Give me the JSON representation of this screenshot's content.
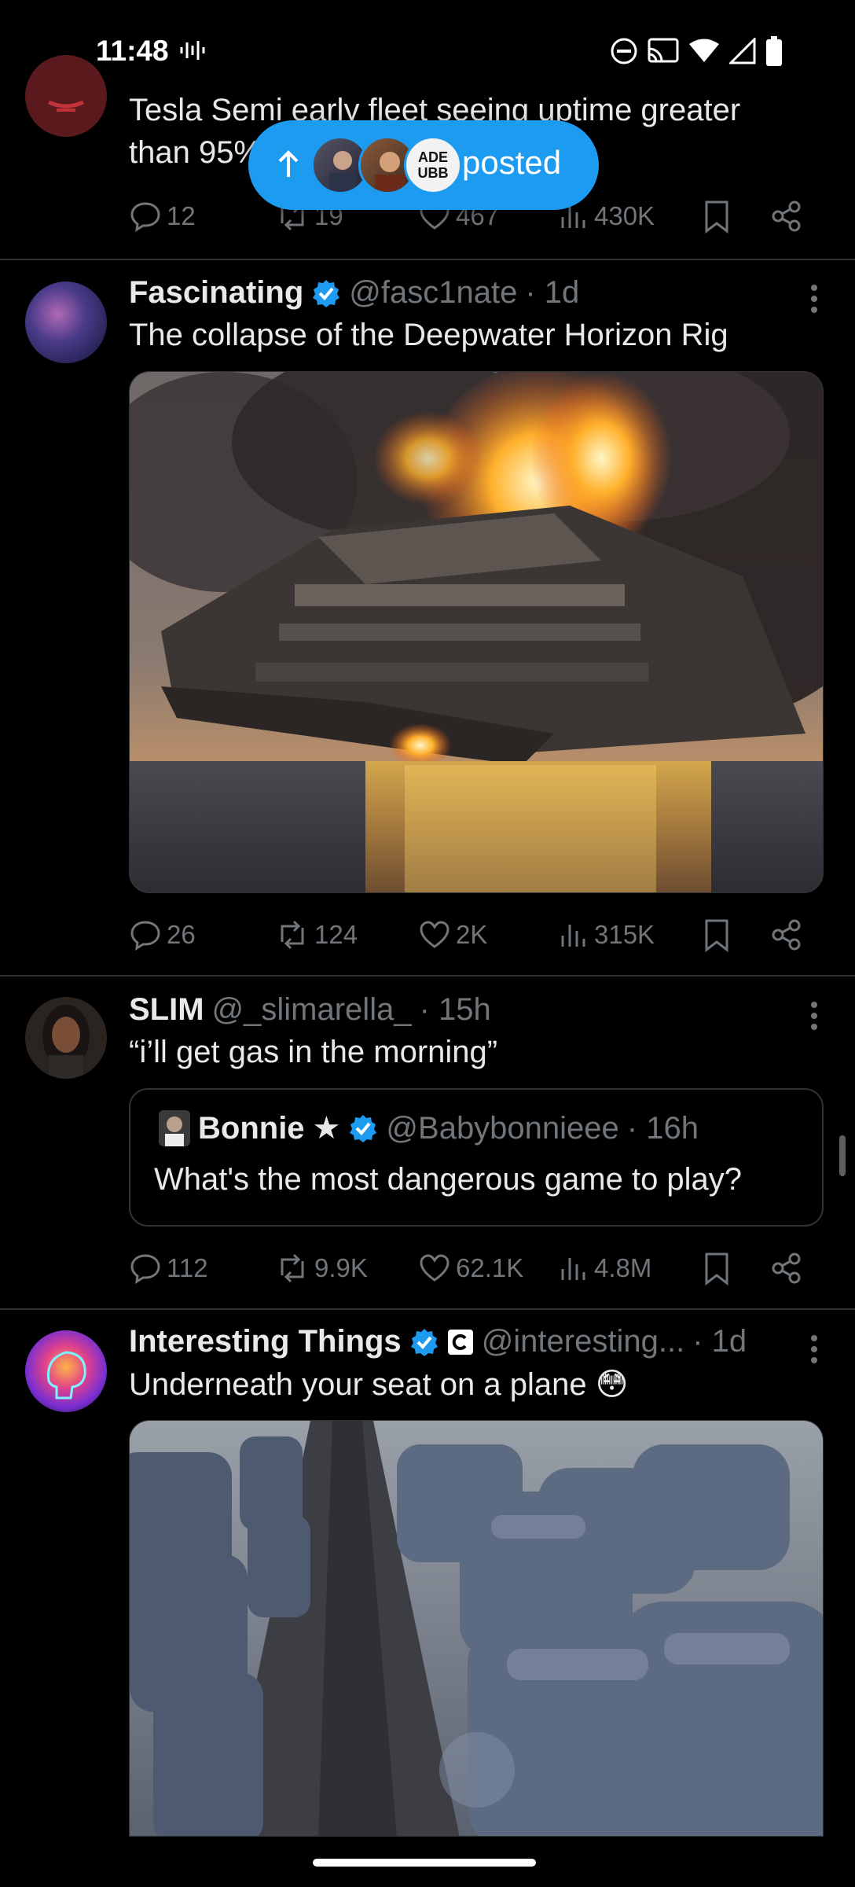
{
  "status_bar": {
    "time": "11:48",
    "icons": [
      "voicemail-icon",
      "dnd-icon",
      "cast-icon",
      "wifi-icon",
      "signal-icon",
      "battery-icon"
    ]
  },
  "posted_pill": {
    "label": "posted",
    "avatar_badge_text": "ADE UBB"
  },
  "posts": [
    {
      "text_line1": "Tesla Semi early fleet seeing uptime greater",
      "text_line2": "than 95%",
      "replies": "12",
      "reposts": "19",
      "likes": "467",
      "views": "430K"
    },
    {
      "name": "Fascinating",
      "verified": true,
      "handle": "@fasc1nate",
      "time": "· 1d",
      "text": "The collapse of the Deepwater Horizon Rig",
      "media_type": "photo",
      "replies": "26",
      "reposts": "124",
      "likes": "2K",
      "views": "315K"
    },
    {
      "name": "SLIM",
      "handle": "@_slimarella_",
      "time": "· 15h",
      "text": "“i’ll get gas in the morning”",
      "quote": {
        "name": "Bonnie",
        "name_suffix": "★",
        "verified": true,
        "handle": "@Babybonnieee",
        "time": "· 16h",
        "text": "What's the most dangerous game to play?"
      },
      "replies": "112",
      "reposts": "9.9K",
      "likes": "62.1K",
      "views": "4.8M"
    },
    {
      "name": "Interesting Things",
      "verified": true,
      "handle": "@interesting...",
      "time": "· 1d",
      "text": "Underneath your seat on a plane 😳",
      "media_type": "video"
    }
  ],
  "colors": {
    "background": "#000000",
    "text": "#e7e9ea",
    "secondary_text": "#71767b",
    "accent": "#1d9bf0",
    "divider": "#2f3336"
  }
}
